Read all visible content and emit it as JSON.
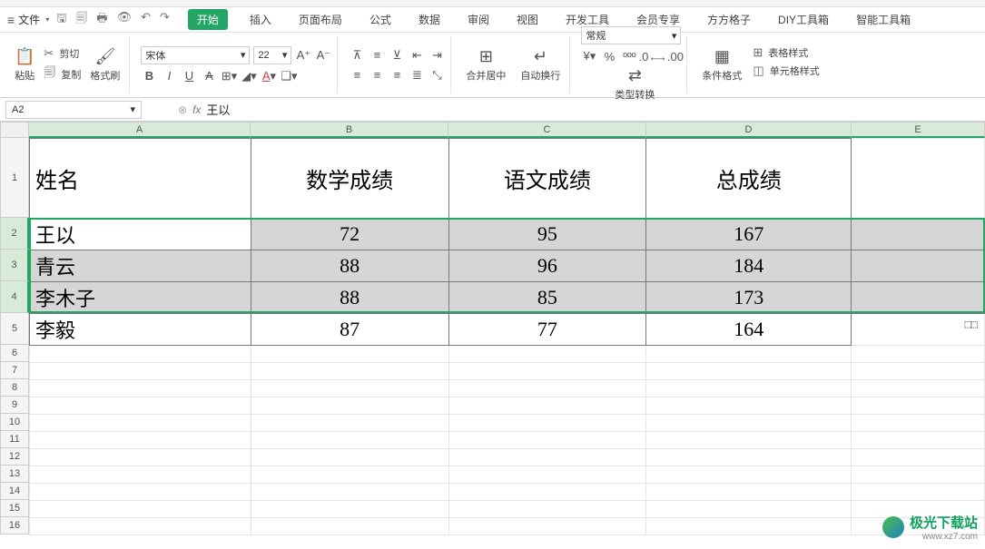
{
  "menu": {
    "file": "文件",
    "tabs": [
      "开始",
      "插入",
      "页面布局",
      "公式",
      "数据",
      "审阅",
      "视图",
      "开发工具",
      "会员专享",
      "方方格子",
      "DIY工具箱",
      "智能工具箱"
    ],
    "active_tab_index": 0
  },
  "ribbon": {
    "paste": "粘贴",
    "cut": "剪切",
    "copy": "复制",
    "format_painter": "格式刷",
    "font_name": "宋体",
    "font_size": "22",
    "merge_center": "合并居中",
    "auto_wrap": "自动换行",
    "number_format": "常规",
    "type_convert": "类型转换",
    "conditional_format": "条件格式",
    "table_style": "表格样式",
    "cell_style": "单元格样式"
  },
  "formula_bar": {
    "name_box": "A2",
    "fx": "fx",
    "value": "王以"
  },
  "columns": [
    "A",
    "B",
    "C",
    "D",
    "E"
  ],
  "rows_labels": [
    "1",
    "2",
    "3",
    "4",
    "5",
    "6",
    "7",
    "8",
    "9",
    "10",
    "11",
    "12",
    "13",
    "14",
    "15",
    "16"
  ],
  "sheet": {
    "headers": [
      "姓名",
      "数学成绩",
      "语文成绩",
      "总成绩"
    ],
    "data": [
      {
        "name": "王以",
        "math": 72,
        "chinese": 95,
        "total": 167
      },
      {
        "name": "青云",
        "math": 88,
        "chinese": 96,
        "total": 184
      },
      {
        "name": "李木子",
        "math": 88,
        "chinese": 85,
        "total": 173
      },
      {
        "name": "李毅",
        "math": 87,
        "chinese": 77,
        "total": 164
      }
    ]
  },
  "selection": {
    "active_cell": "A2",
    "range": "A2:E4"
  },
  "watermark": {
    "text": "极光下载站",
    "url": "www.xz7.com"
  },
  "chart_data": {
    "type": "table",
    "title": "",
    "columns": [
      "姓名",
      "数学成绩",
      "语文成绩",
      "总成绩"
    ],
    "rows": [
      [
        "王以",
        72,
        95,
        167
      ],
      [
        "青云",
        88,
        96,
        184
      ],
      [
        "李木子",
        88,
        85,
        173
      ],
      [
        "李毅",
        87,
        77,
        164
      ]
    ]
  }
}
